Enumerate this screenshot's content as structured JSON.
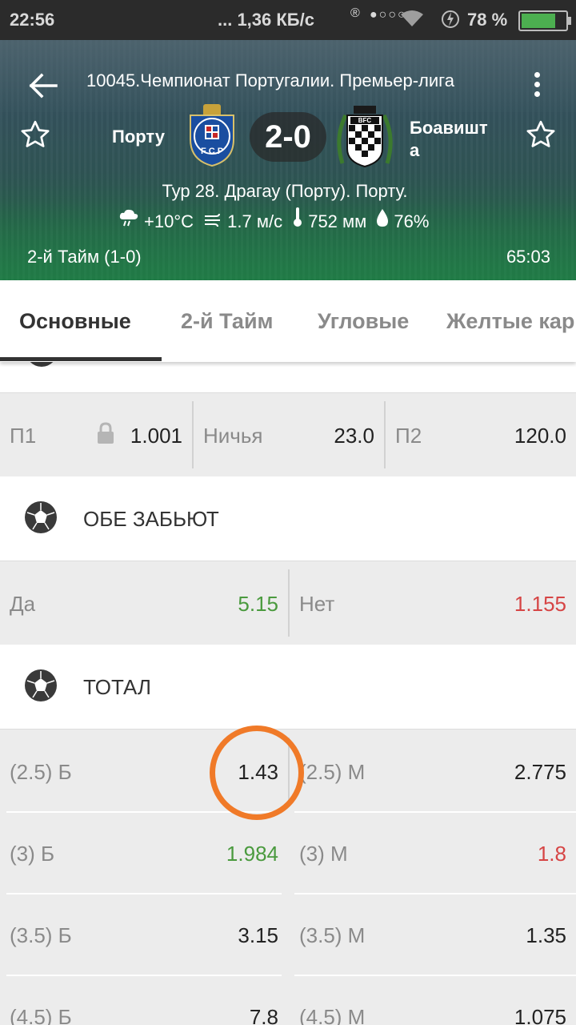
{
  "status_bar": {
    "time": "22:56",
    "network": "... 1,36 КБ/с",
    "battery": "78 %",
    "battery_level": 0.78,
    "battery_color": "#4caf50"
  },
  "header": {
    "league": "10045.Чемпионат Португалии. Премьер-лига",
    "home_team": "Порту",
    "away_team": "Боавишт а",
    "score": "2-0",
    "info": "Тур 28. Драгау (Порту). Порту.",
    "weather": {
      "temp": "+10°C",
      "wind": "1.7 м/с",
      "pressure": "752 мм",
      "humidity": "76%"
    },
    "period": "2-й  Тайм (1-0)",
    "clock": "65:03"
  },
  "tabs": [
    "Основные",
    "2-й  Тайм",
    "Угловые",
    "Желтые кар"
  ],
  "markets": {
    "result": [
      {
        "label": "П1",
        "value": "1.001",
        "locked": true
      },
      {
        "label": "Ничья",
        "value": "23.0"
      },
      {
        "label": "П2",
        "value": "120.0"
      }
    ],
    "both_score": {
      "title": "ОБЕ ЗАБЬЮТ",
      "yes_label": "Да",
      "yes_value": "5.15",
      "no_label": "Нет",
      "no_value": "1.155"
    },
    "total": {
      "title": "ТОТАЛ",
      "rows": [
        {
          "over_label": "(2.5) Б",
          "over_value": "1.43",
          "under_label": "(2.5) М",
          "under_value": "2.775"
        },
        {
          "over_label": "(3) Б",
          "over_value": "1.984",
          "under_label": "(3) М",
          "under_value": "1.8"
        },
        {
          "over_label": "(3.5) Б",
          "over_value": "3.15",
          "under_label": "(3.5) М",
          "under_value": "1.35"
        },
        {
          "over_label": "(4.5) Б",
          "over_value": "7.8",
          "under_label": "(4.5) М",
          "under_value": "1.075"
        }
      ]
    }
  },
  "colors": {
    "odds_up": "#4a9a3e",
    "odds_down": "#d64545",
    "highlight_circle": "#f07a28"
  }
}
